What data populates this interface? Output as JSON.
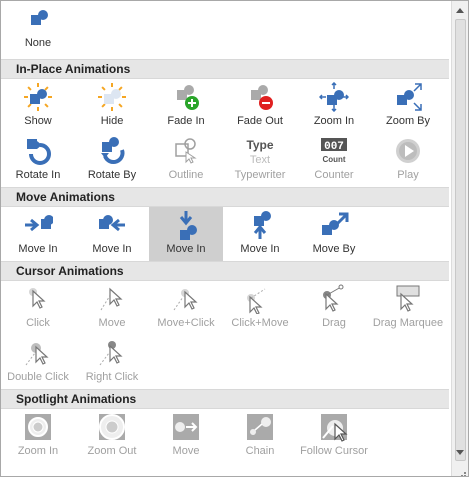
{
  "colors": {
    "blue": "#3a6fb7",
    "gray": "#555555",
    "orange": "#f5a623",
    "green": "#2aa52a",
    "red": "#e02020",
    "disabled": "#a0a0a0"
  },
  "none": {
    "label": "None",
    "icon": "shapes-icon"
  },
  "sections": [
    {
      "title": "In-Place Animations",
      "rows": [
        [
          {
            "label": "Show",
            "icon": "show-icon"
          },
          {
            "label": "Hide",
            "icon": "hide-icon"
          },
          {
            "label": "Fade In",
            "icon": "fade-in-icon"
          },
          {
            "label": "Fade Out",
            "icon": "fade-out-icon"
          },
          {
            "label": "Zoom In",
            "icon": "zoom-in-icon"
          },
          {
            "label": "Zoom By",
            "icon": "zoom-by-icon"
          }
        ],
        [
          {
            "label": "Rotate In",
            "icon": "rotate-in-icon"
          },
          {
            "label": "Rotate By",
            "icon": "rotate-by-icon"
          },
          {
            "label": "Outline",
            "icon": "outline-icon",
            "disabled": true
          },
          {
            "label": "Typewriter",
            "icon": "typewriter-icon",
            "disabled": true,
            "text1": "Type",
            "text2": "Text"
          },
          {
            "label": "Counter",
            "icon": "counter-icon",
            "disabled": true,
            "text1": "007",
            "text2": "Count"
          },
          {
            "label": "Play",
            "icon": "play-icon",
            "disabled": true
          }
        ]
      ]
    },
    {
      "title": "Move Animations",
      "rows": [
        [
          {
            "label": "Move In",
            "icon": "move-in-left-icon"
          },
          {
            "label": "Move In",
            "icon": "move-in-right-icon"
          },
          {
            "label": "Move In",
            "icon": "move-in-down-icon",
            "selected": true
          },
          {
            "label": "Move In",
            "icon": "move-in-up-icon"
          },
          {
            "label": "Move By",
            "icon": "move-by-icon"
          }
        ]
      ]
    },
    {
      "title": "Cursor Animations",
      "rows": [
        [
          {
            "label": "Click",
            "icon": "cursor-click-icon",
            "disabled": true
          },
          {
            "label": "Move",
            "icon": "cursor-move-icon",
            "disabled": true
          },
          {
            "label": "Move+Click",
            "icon": "cursor-move-click-icon",
            "disabled": true
          },
          {
            "label": "Click+Move",
            "icon": "cursor-click-move-icon",
            "disabled": true
          },
          {
            "label": "Drag",
            "icon": "cursor-drag-icon",
            "disabled": true
          },
          {
            "label": "Drag Marquee",
            "icon": "cursor-drag-marquee-icon",
            "disabled": true
          }
        ],
        [
          {
            "label": "Double Click",
            "icon": "cursor-double-click-icon",
            "disabled": true
          },
          {
            "label": "Right Click",
            "icon": "cursor-right-click-icon",
            "disabled": true
          }
        ]
      ]
    },
    {
      "title": "Spotlight Animations",
      "rows": [
        [
          {
            "label": "Zoom In",
            "icon": "spotlight-zoom-in-icon",
            "disabled": true
          },
          {
            "label": "Zoom Out",
            "icon": "spotlight-zoom-out-icon",
            "disabled": true
          },
          {
            "label": "Move",
            "icon": "spotlight-move-icon",
            "disabled": true
          },
          {
            "label": "Chain",
            "icon": "spotlight-chain-icon",
            "disabled": true
          },
          {
            "label": "Follow Cursor",
            "icon": "spotlight-follow-cursor-icon",
            "disabled": true
          }
        ]
      ]
    }
  ]
}
